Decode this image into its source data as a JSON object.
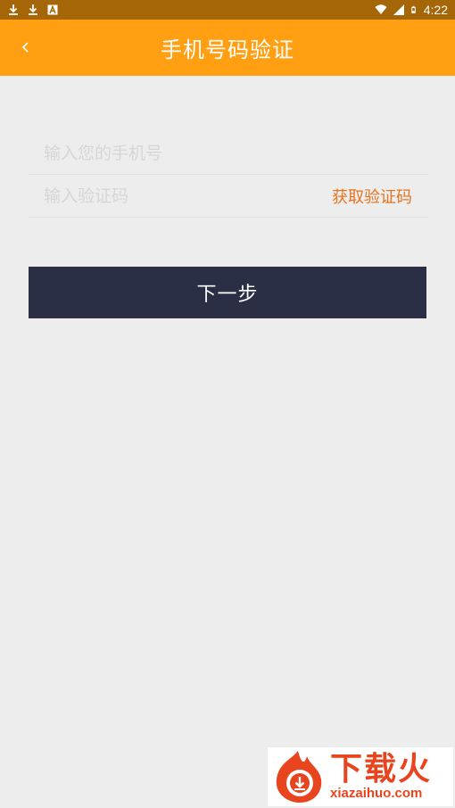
{
  "status_bar": {
    "time": "4:22",
    "left_icons": [
      "download-icon",
      "download-icon",
      "a-box-icon"
    ],
    "right_icons": [
      "wifi-icon",
      "cell-signal-icon",
      "battery-icon"
    ]
  },
  "app_bar": {
    "back_icon": "chevron-left-icon",
    "title": "手机号码验证"
  },
  "form": {
    "phone": {
      "value": "",
      "placeholder": "输入您的手机号"
    },
    "code": {
      "value": "",
      "placeholder": "输入验证码"
    },
    "get_code_label": "获取验证码"
  },
  "next_button_label": "下一步",
  "watermark": {
    "name_cn": "下载火",
    "name_en": "xiazaihuo.com"
  },
  "colors": {
    "status_bar": "#a46606",
    "app_bar": "#ff9f11",
    "accent_text": "#e8741e",
    "button": "#2a2f46",
    "background": "#ededed"
  }
}
